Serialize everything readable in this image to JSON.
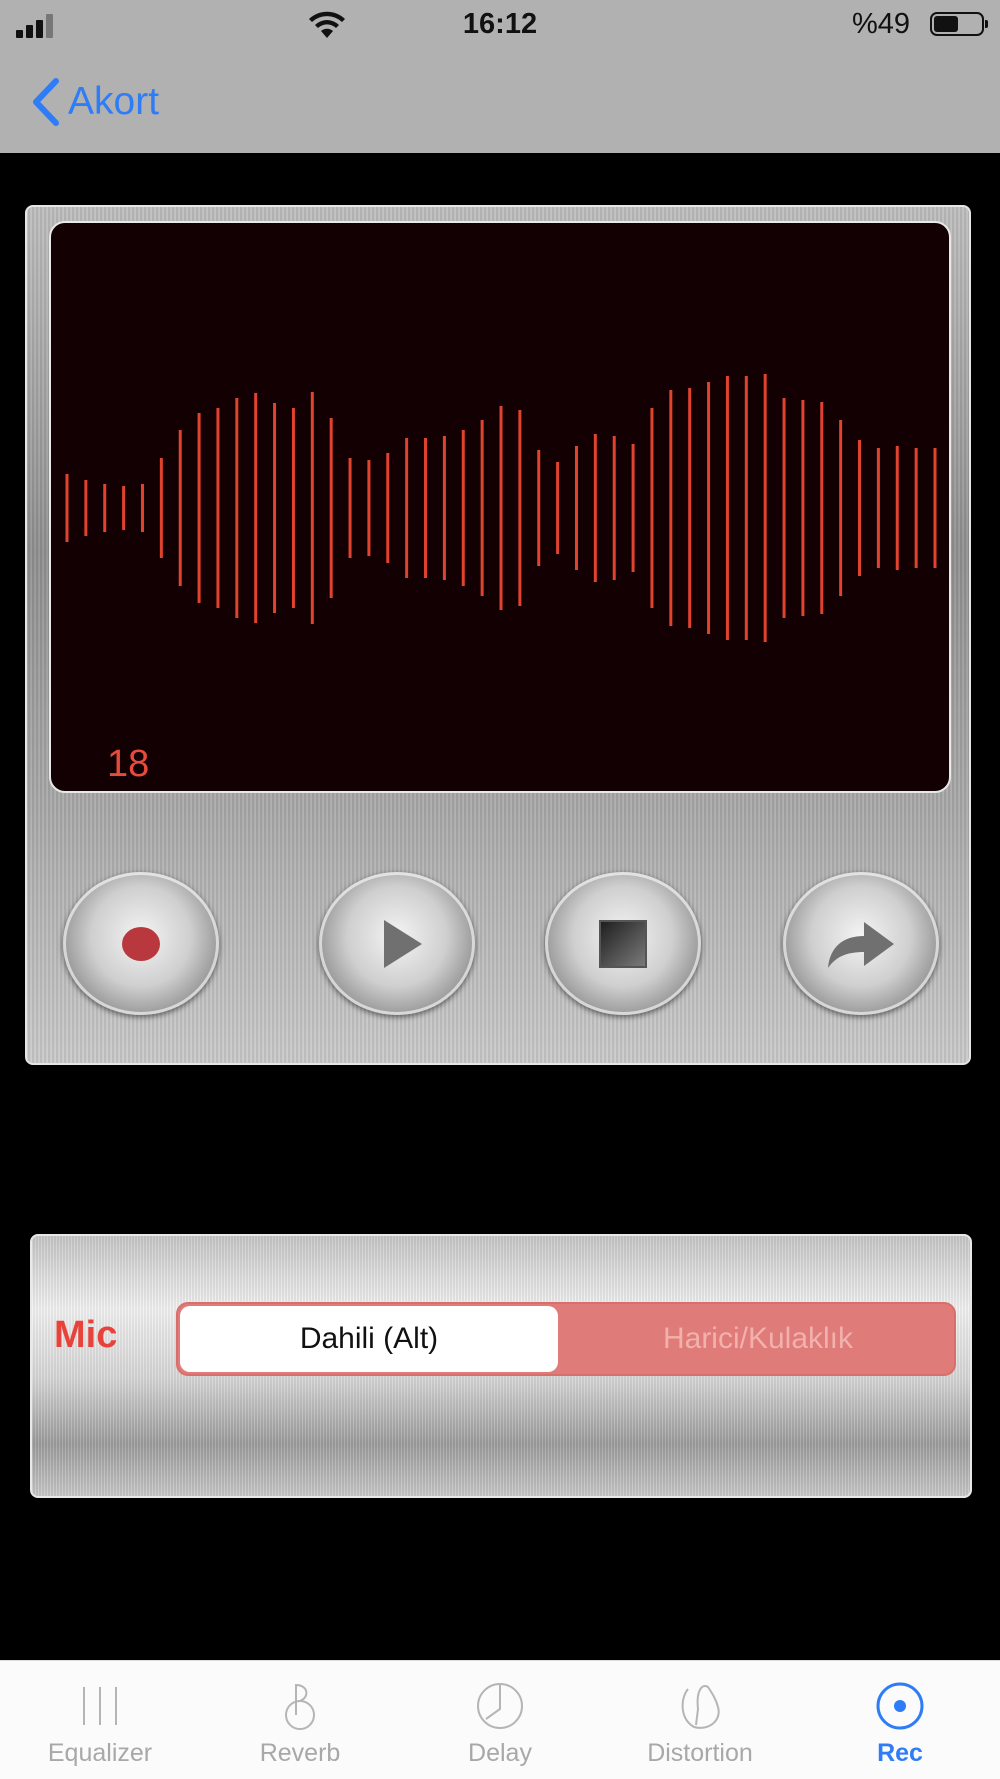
{
  "status_bar": {
    "time": "16:12",
    "battery": "%49"
  },
  "nav": {
    "back_label": "Akort"
  },
  "recorder": {
    "counter": "18",
    "buttons": [
      "record",
      "play",
      "stop",
      "share"
    ]
  },
  "mic": {
    "label": "Mic",
    "options": [
      "Dahili (Alt)",
      "Harici/Kulaklık"
    ],
    "selected": "Dahili (Alt)"
  },
  "tabs": [
    {
      "label": "Equalizer",
      "icon": "equalizer-icon"
    },
    {
      "label": "Reverb",
      "icon": "reverb-icon"
    },
    {
      "label": "Delay",
      "icon": "delay-icon"
    },
    {
      "label": "Distortion",
      "icon": "distortion-icon"
    },
    {
      "label": "Rec",
      "icon": "rec-icon",
      "active": true
    }
  ],
  "colors": {
    "accent": "#2f7df6",
    "wave": "#e2432f",
    "mic_label": "#e8433a",
    "segment": "#df7b78"
  }
}
